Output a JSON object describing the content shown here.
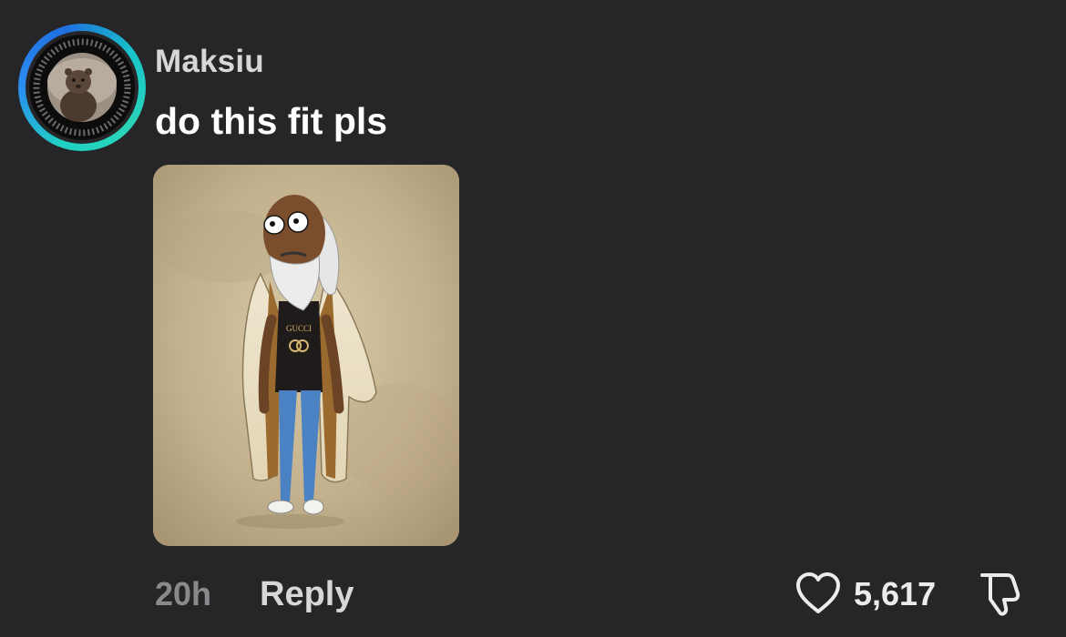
{
  "comment": {
    "username": "Maksiu",
    "text": "do this fit pls",
    "time": "20h",
    "reply_label": "Reply",
    "like_count": "5,617",
    "image_shirt_text": "GUCCI"
  },
  "icons": {
    "like": "heart-outline-icon",
    "dislike": "thumbs-down-outline-icon"
  },
  "colors": {
    "background": "#262628",
    "avatar_ring": "#1fb5d9"
  }
}
